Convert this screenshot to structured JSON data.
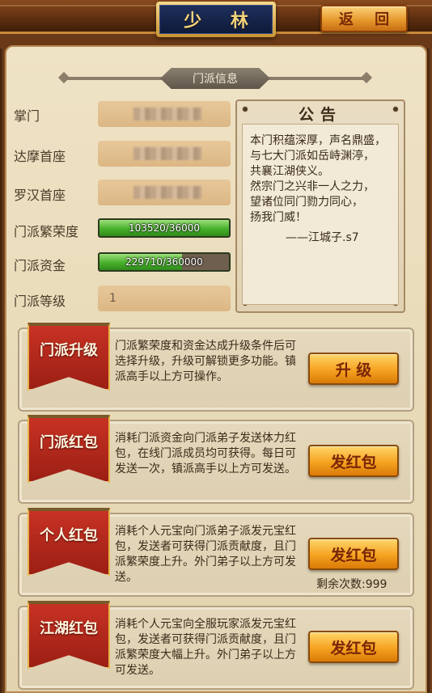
{
  "header": {
    "title": "少 林",
    "seal": "",
    "back_label": "返 回"
  },
  "section": {
    "title": "门派信息"
  },
  "info": {
    "leader_label": "掌门",
    "leader_value": "",
    "damo_label": "达摩首座",
    "damo_value": "",
    "luohan_label": "罗汉首座",
    "luohan_value": "",
    "prosperity_label": "门派繁荣度",
    "prosperity_text": "103520/36000",
    "prosperity_fraction": 1.0,
    "funds_label": "门派资金",
    "funds_text": "229710/360000",
    "funds_fraction": 0.64,
    "level_label": "门派等级",
    "level_value": "1"
  },
  "notice": {
    "title": "公告",
    "lines": [
      "本门积蕴深厚，声名鼎盛，",
      "与七大门派如岳峙渊渟，",
      "共襄江湖侠义。",
      "然宗门之兴非一人之力，",
      "望诸位同门勠力同心，",
      "扬我门威！"
    ],
    "signature": "——江城子.s7"
  },
  "cards": [
    {
      "banner": "门派升级",
      "desc": "门派繁荣度和资金达成升级条件后可选择升级，升级可解锁更多功能。镇派高手以上方可操作。",
      "button": "升 级",
      "note": ""
    },
    {
      "banner": "门派红包",
      "desc": "消耗门派资金向门派弟子发送体力红包，在线门派成员均可获得。每日可发送一次，镇派高手以上方可发送。",
      "button": "发红包",
      "note": ""
    },
    {
      "banner": "个人红包",
      "desc": "消耗个人元宝向门派弟子派发元宝红包，发送者可获得门派贡献度，且门派繁荣度上升。外门弟子以上方可发送。",
      "button": "发红包",
      "note": "剩余次数:999"
    },
    {
      "banner": "江湖红包",
      "desc": "消耗个人元宝向全服玩家派发元宝红包，发送者可获得门派贡献度，且门派繁荣度大幅上升。外门弟子以上方可发送。",
      "button": "发红包",
      "note": ""
    }
  ],
  "colors": {
    "accent_gold": "#f5a220",
    "banner_red": "#c73224",
    "bar_green": "#47b02c",
    "parchment": "#e8dbb9"
  }
}
